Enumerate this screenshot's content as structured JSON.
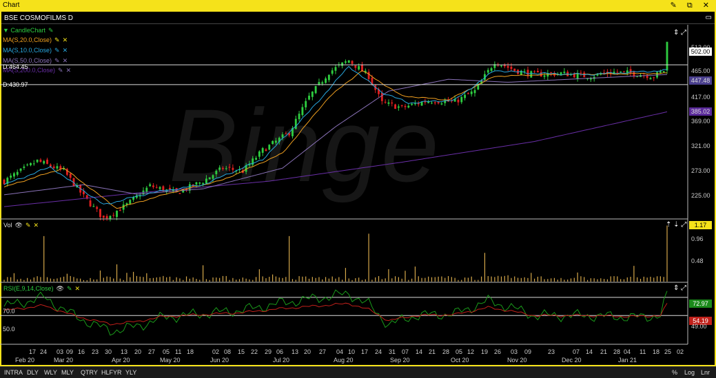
{
  "window": {
    "title": "Chart",
    "controls": "✎ ⧉ ✕"
  },
  "symbol": {
    "label": "BSE COSMOFILMS D",
    "menu": "▭"
  },
  "price_pane": {
    "legend": [
      {
        "text": "CandleChart",
        "color": "#2ecc40"
      },
      {
        "text": "MA(S,20.0,Close)",
        "color": "#f0a020"
      },
      {
        "text": "MA(S,10.0,Close)",
        "color": "#29a8e0"
      },
      {
        "text": "MA(S,50.0,Close)",
        "color": "#8a72b8"
      },
      {
        "text": "MA(S,200.0,Close)",
        "color": "#6a2fa8"
      }
    ],
    "h_lines": [
      {
        "label": "D:464.45",
        "value": 464.45
      },
      {
        "label": "D:430.97",
        "value": 430.97
      }
    ],
    "y_ticks": [
      "513.00",
      "465.00",
      "417.00",
      "369.00",
      "321.00",
      "273.00",
      "225.00"
    ],
    "last_price": "502.00",
    "ma_box_1": "447.48",
    "ma_box_2": "385.02",
    "watermark": "Binge"
  },
  "vol_pane": {
    "label": "Vol",
    "y_ticks": [
      "0.96",
      "0.48"
    ],
    "last": "1.17"
  },
  "rsi_pane": {
    "label": "RSI(E,9,14,Close)",
    "levels": [
      "70.0",
      "50.0"
    ],
    "y_ticks": [
      "49.00"
    ],
    "rsi_box": "72.97",
    "sig_box": "54.19"
  },
  "x_axis": {
    "days": [
      "17",
      "24",
      "03",
      "09",
      "16",
      "23",
      "30",
      "13",
      "20",
      "27",
      "05",
      "11",
      "18",
      "02",
      "08",
      "15",
      "22",
      "29",
      "06",
      "13",
      "20",
      "27",
      "04",
      "10",
      "17",
      "24",
      "31",
      "07",
      "14",
      "21",
      "28",
      "05",
      "12",
      "19",
      "26",
      "03",
      "09",
      "23",
      "07",
      "14",
      "21",
      "28",
      "04",
      "11",
      "18",
      "25",
      "02"
    ],
    "months": [
      "Feb 20",
      "Mar 20",
      "Apr 20",
      "May 20",
      "Jun 20",
      "Jul 20",
      "Aug 20",
      "Sep 20",
      "Oct 20",
      "Nov 20",
      "Dec 20",
      "Jan 21"
    ]
  },
  "bottom": {
    "timeframes": [
      "INTRA",
      "DLY",
      "WLY",
      "MLY",
      "QTRY",
      "HLFYR",
      "YLY"
    ],
    "right": [
      "%",
      "Log",
      "Lnr"
    ]
  },
  "chart_data": {
    "type": "candlestick",
    "title": "BSE COSMOFILMS D",
    "ylim": [
      210,
      525
    ],
    "anchors_close": [
      [
        0,
        268
      ],
      [
        10,
        302
      ],
      [
        18,
        285
      ],
      [
        24,
        242
      ],
      [
        30,
        205
      ],
      [
        37,
        228
      ],
      [
        44,
        260
      ],
      [
        52,
        248
      ],
      [
        60,
        268
      ],
      [
        66,
        290
      ],
      [
        72,
        285
      ],
      [
        78,
        320
      ],
      [
        86,
        350
      ],
      [
        92,
        410
      ],
      [
        98,
        452
      ],
      [
        104,
        472
      ],
      [
        110,
        445
      ],
      [
        114,
        400
      ],
      [
        120,
        392
      ],
      [
        128,
        404
      ],
      [
        136,
        402
      ],
      [
        142,
        420
      ],
      [
        148,
        470
      ],
      [
        154,
        455
      ],
      [
        160,
        448
      ],
      [
        168,
        450
      ],
      [
        176,
        445
      ],
      [
        184,
        452
      ],
      [
        190,
        450
      ],
      [
        196,
        445
      ],
      [
        199,
        455
      ],
      [
        200,
        502
      ]
    ],
    "ma10_anchors": [
      [
        0,
        262
      ],
      [
        14,
        292
      ],
      [
        30,
        228
      ],
      [
        44,
        248
      ],
      [
        60,
        262
      ],
      [
        78,
        305
      ],
      [
        92,
        385
      ],
      [
        104,
        462
      ],
      [
        114,
        418
      ],
      [
        122,
        400
      ],
      [
        136,
        405
      ],
      [
        148,
        455
      ],
      [
        160,
        450
      ],
      [
        176,
        448
      ],
      [
        200,
        455
      ]
    ],
    "ma20_anchors": [
      [
        0,
        258
      ],
      [
        18,
        290
      ],
      [
        34,
        222
      ],
      [
        50,
        248
      ],
      [
        66,
        270
      ],
      [
        84,
        315
      ],
      [
        98,
        410
      ],
      [
        108,
        455
      ],
      [
        120,
        412
      ],
      [
        134,
        405
      ],
      [
        148,
        445
      ],
      [
        164,
        448
      ],
      [
        200,
        450
      ]
    ],
    "ma50_anchors": [
      [
        0,
        245
      ],
      [
        24,
        262
      ],
      [
        40,
        246
      ],
      [
        60,
        255
      ],
      [
        84,
        290
      ],
      [
        100,
        360
      ],
      [
        116,
        420
      ],
      [
        134,
        440
      ],
      [
        152,
        435
      ],
      [
        200,
        448
      ]
    ],
    "ma200_anchors": [
      [
        0,
        225
      ],
      [
        40,
        248
      ],
      [
        80,
        268
      ],
      [
        120,
        300
      ],
      [
        160,
        335
      ],
      [
        200,
        385
      ]
    ],
    "volume_spikes": [
      [
        12,
        0.95
      ],
      [
        34,
        0.36
      ],
      [
        86,
        0.95
      ],
      [
        110,
        1.0
      ],
      [
        145,
        0.6
      ],
      [
        200,
        1.17
      ]
    ],
    "rsi_anchors": [
      [
        0,
        60
      ],
      [
        12,
        70
      ],
      [
        22,
        48
      ],
      [
        32,
        33
      ],
      [
        40,
        38
      ],
      [
        48,
        48
      ],
      [
        60,
        52
      ],
      [
        72,
        56
      ],
      [
        84,
        64
      ],
      [
        94,
        69
      ],
      [
        104,
        74
      ],
      [
        110,
        62
      ],
      [
        116,
        40
      ],
      [
        124,
        50
      ],
      [
        136,
        52
      ],
      [
        146,
        66
      ],
      [
        152,
        60
      ],
      [
        160,
        50
      ],
      [
        176,
        50
      ],
      [
        190,
        48
      ],
      [
        198,
        50
      ],
      [
        200,
        73
      ]
    ],
    "rsi_signal": "54.19",
    "rsi_last": "72.97"
  }
}
